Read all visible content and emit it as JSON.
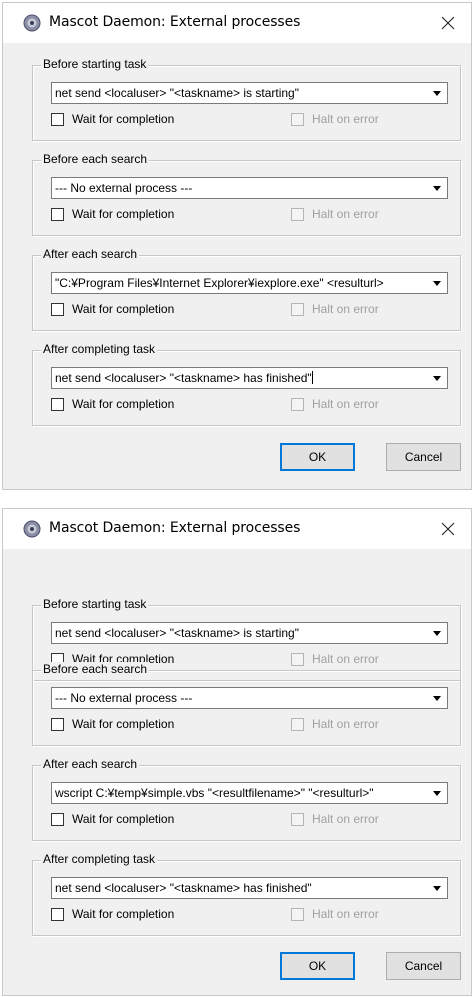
{
  "dialogs": [
    {
      "title": "Mascot Daemon: External processes",
      "groups": [
        {
          "legend": "Before starting task",
          "value": "net send <localuser> \"<taskname> is starting\"",
          "wait_label": "Wait for completion",
          "halt_label": "Halt on error"
        },
        {
          "legend": "Before each search",
          "value": "--- No external process ---",
          "wait_label": "Wait for completion",
          "halt_label": "Halt on error"
        },
        {
          "legend": "After each search",
          "value": "\"C:¥Program Files¥Internet Explorer¥iexplore.exe\" <resulturl>",
          "wait_label": "Wait for completion",
          "halt_label": "Halt on error"
        },
        {
          "legend": "After completing task",
          "value": "net send <localuser> \"<taskname> has finished\"",
          "wait_label": "Wait for completion",
          "halt_label": "Halt on error"
        }
      ],
      "ok_label": "OK",
      "cancel_label": "Cancel"
    },
    {
      "title": "Mascot Daemon: External processes",
      "groups": [
        {
          "legend": "Before starting task",
          "value": "net send <localuser> \"<taskname> is starting\"",
          "wait_label": "Wait for completion",
          "halt_label": "Halt on error"
        },
        {
          "legend": "Before each search",
          "value": "--- No external process ---",
          "wait_label": "Wait for completion",
          "halt_label": "Halt on error"
        },
        {
          "legend": "After each search",
          "value": "wscript C:¥temp¥simple.vbs \"<resultfilename>\" \"<resulturl>\"",
          "wait_label": "Wait for completion",
          "halt_label": "Halt on error"
        },
        {
          "legend": "After completing task",
          "value": "net send <localuser> \"<taskname> has finished\"",
          "wait_label": "Wait for completion",
          "halt_label": "Halt on error"
        }
      ],
      "ok_label": "OK",
      "cancel_label": "Cancel"
    }
  ],
  "icons": {
    "app": "mascot-daemon-icon",
    "close": "close-icon",
    "dropdown": "chevron-down-icon"
  },
  "colors": {
    "dialog_bg": "#f0f0f0",
    "titlebar_bg": "#ffffff",
    "default_button_border": "#0078d7",
    "disabled_text": "#a0a0a0"
  }
}
